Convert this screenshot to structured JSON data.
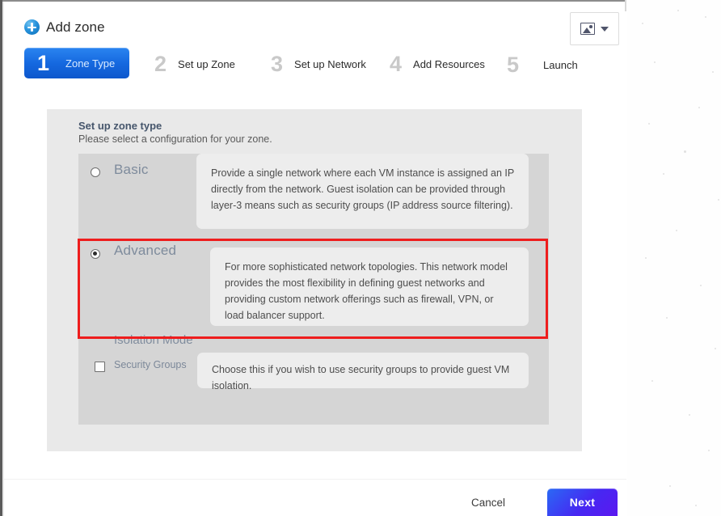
{
  "header": {
    "title": "Add zone",
    "add_icon": "add-circle-icon",
    "image_button": {
      "icon": "image-icon",
      "caret": "chevron-down-icon"
    }
  },
  "wizard": {
    "steps": [
      {
        "number": "1",
        "label": "Zone Type",
        "active": true
      },
      {
        "number": "2",
        "label": "Set up Zone",
        "active": false
      },
      {
        "number": "3",
        "label": "Set up Network",
        "active": false
      },
      {
        "number": "4",
        "label": "Add Resources",
        "active": false
      },
      {
        "number": "5",
        "label": "Launch",
        "active": false
      }
    ]
  },
  "section": {
    "title": "Set up zone type",
    "subtitle": "Please select a configuration for your zone."
  },
  "zone_type_options": [
    {
      "id": "basic",
      "label": "Basic",
      "selected": false,
      "description": "Provide a single network where each VM instance is assigned an IP directly from the network. Guest isolation can be provided through layer-3 means such as security groups (IP address source filtering)."
    },
    {
      "id": "advanced",
      "label": "Advanced",
      "selected": true,
      "highlighted": true,
      "description": "For more sophisticated network topologies. This network model provides the most flexibility in defining guest networks and providing custom network offerings such as firewall, VPN, or load balancer support."
    }
  ],
  "isolation_mode": {
    "title": "Isolation Mode",
    "checkbox": {
      "label": "Security Groups",
      "checked": false,
      "description": "Choose this if you wish to use security groups to provide guest VM isolation."
    }
  },
  "footer": {
    "cancel_label": "Cancel",
    "next_label": "Next"
  },
  "colors": {
    "accent_blue": "#1568df",
    "next_gradient_start": "#2a6af5",
    "next_gradient_end": "#5b18f0",
    "annotation_red": "#ee1d1d",
    "panel_gray": "#e9e9e9",
    "group_gray": "#d5d5d5",
    "desc_gray": "#ededed",
    "label_blue_gray": "#7e8b9c"
  }
}
